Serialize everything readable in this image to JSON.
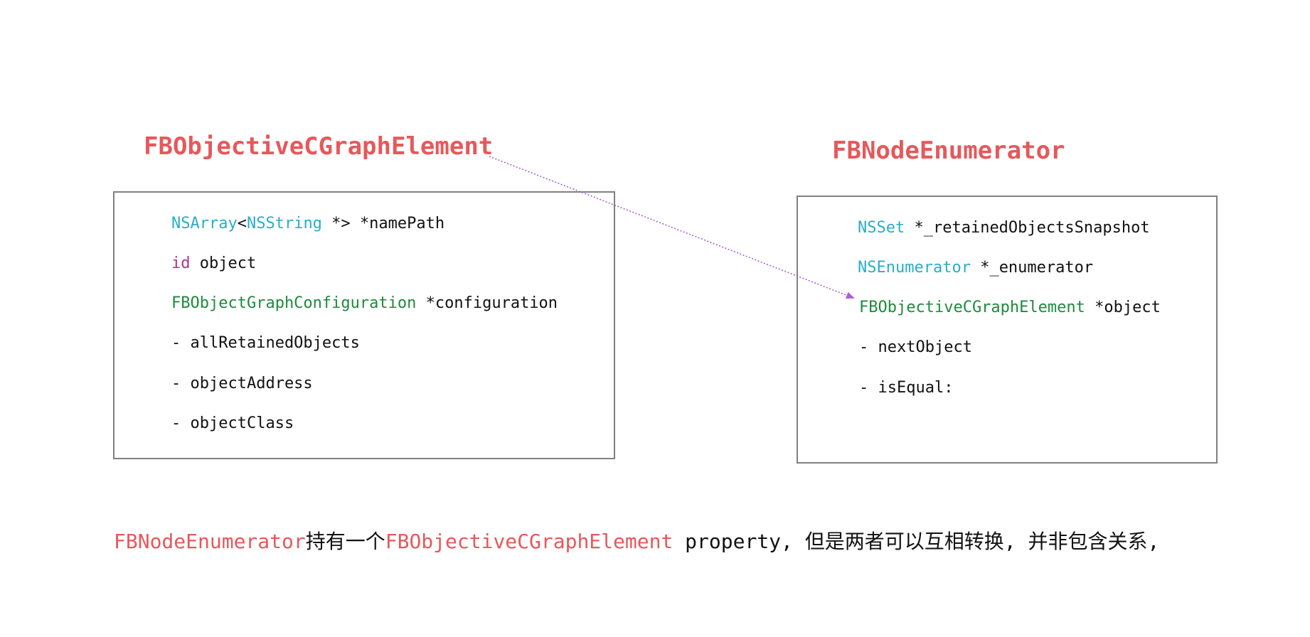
{
  "left_class": {
    "title": "FBObjectiveCGraphElement",
    "lines": [
      {
        "type": "NSArray",
        "mid": "<",
        "type2": "NSString",
        "rest": " *> *namePath"
      },
      {
        "keyword": "id",
        "rest": " object"
      },
      {
        "type": "FBObjectGraphConfiguration",
        "rest": " *configuration"
      },
      {
        "text": "- allRetainedObjects"
      },
      {
        "text": "- objectAddress"
      },
      {
        "text": "- objectClass"
      }
    ]
  },
  "right_class": {
    "title": "FBNodeEnumerator",
    "lines": [
      {
        "type": "NSSet",
        "rest": " *_retainedObjectsSnapshot"
      },
      {
        "type": "NSEnumerator",
        "rest": " *_enumerator"
      },
      {
        "type": "FBObjectiveCGraphElement",
        "rest": " *object"
      },
      {
        "text": "- nextObject"
      },
      {
        "text": "- isEqual:"
      }
    ]
  },
  "caption": {
    "part1": "FBNodeEnumerator",
    "part2": "持有一个",
    "part3": "FBObjectiveCGraphElement",
    "part4": " property, 但是两者可以互相转换, 并非包含关系,"
  },
  "colors": {
    "title_red": "#e5595b",
    "type_cyan": "#29aec7",
    "type_green": "#1e8a3c",
    "keyword_magenta": "#b0328e",
    "arrow_purple": "#a55fd9",
    "box_border": "#808080"
  }
}
